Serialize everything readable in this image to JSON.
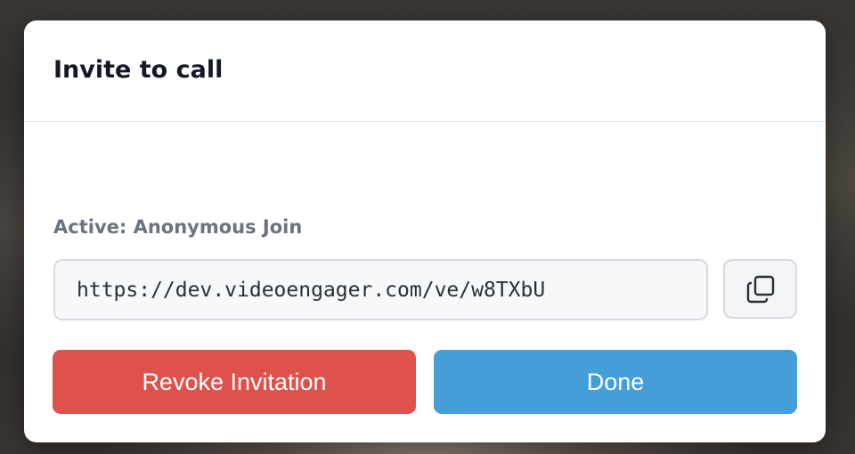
{
  "modal": {
    "title": "Invite to call",
    "status_label": "Active: Anonymous Join",
    "invite_link": "https://dev.videoengager.com/ve/w8TXbU",
    "copy_icon": "copy-icon",
    "revoke_label": "Revoke Invitation",
    "done_label": "Done"
  },
  "colors": {
    "revoke": "#de524c",
    "done": "#449fd8",
    "title": "#111827",
    "muted": "#6b7280"
  }
}
